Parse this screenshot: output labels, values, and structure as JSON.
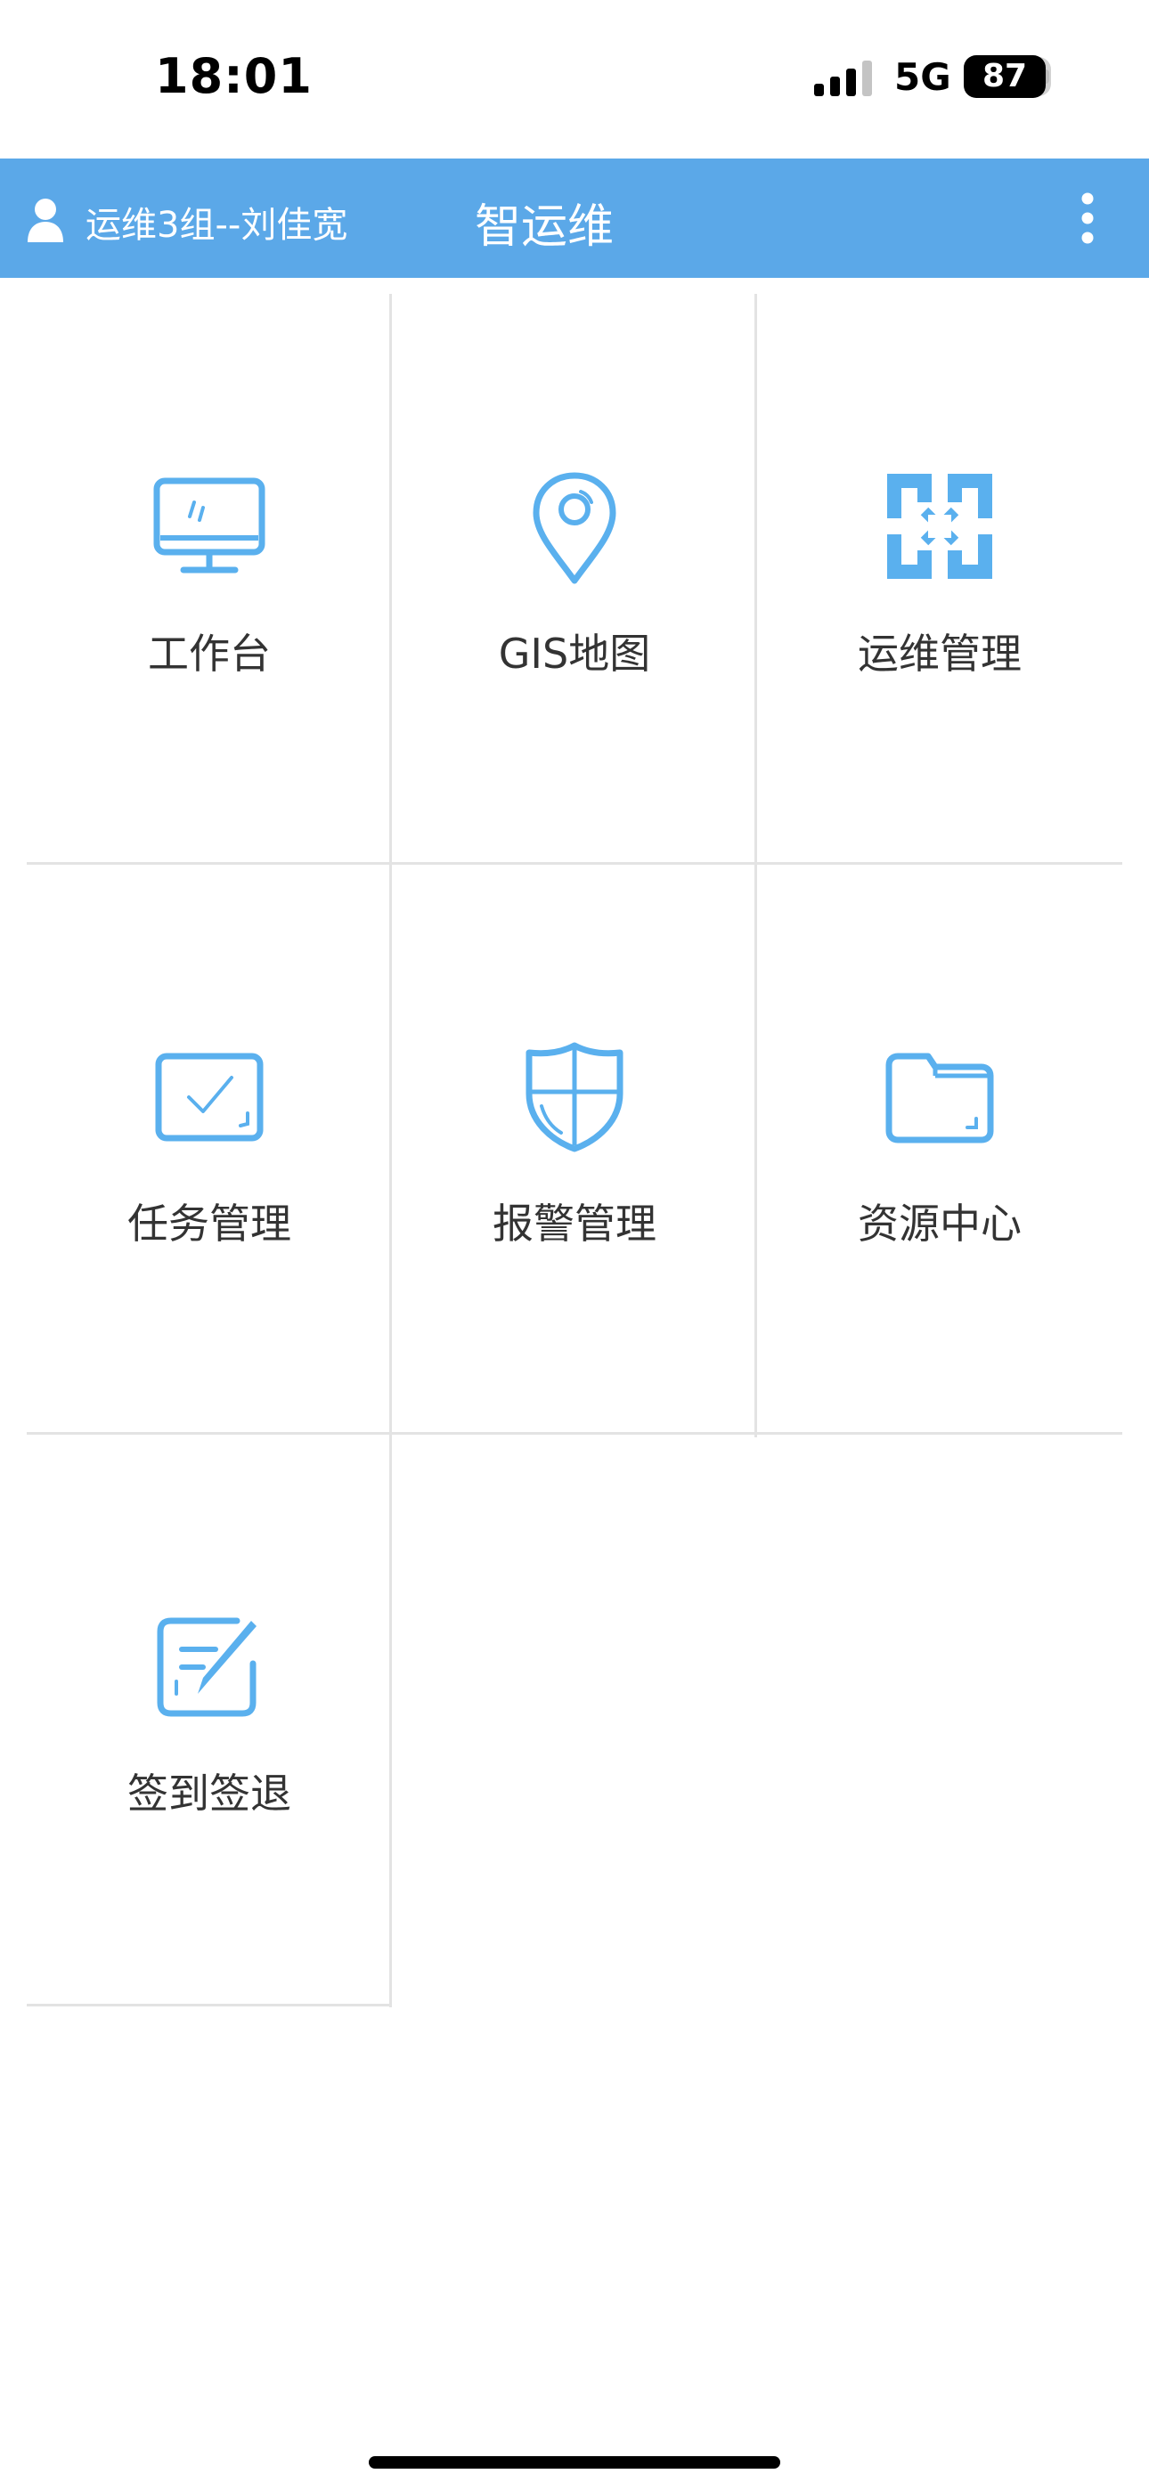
{
  "status_bar": {
    "time": "18:01",
    "network": "5G",
    "battery": "87"
  },
  "header": {
    "user_label": "运维3组--刘佳宽",
    "title": "智运维",
    "accent_color": "#5ba8e8"
  },
  "menu": {
    "items": [
      {
        "label": "工作台",
        "icon": "monitor-icon"
      },
      {
        "label": "GIS地图",
        "icon": "location-pin-icon"
      },
      {
        "label": "运维管理",
        "icon": "grid-blocks-icon"
      },
      {
        "label": "任务管理",
        "icon": "task-check-icon"
      },
      {
        "label": "报警管理",
        "icon": "shield-icon"
      },
      {
        "label": "资源中心",
        "icon": "folder-icon"
      },
      {
        "label": "签到签退",
        "icon": "edit-note-icon"
      }
    ]
  },
  "icon_color": "#5ab0ee"
}
